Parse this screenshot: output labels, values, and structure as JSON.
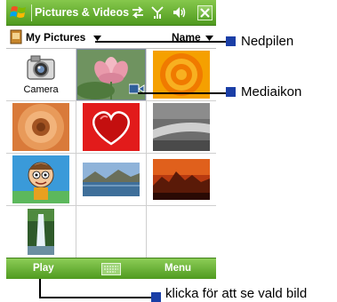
{
  "title_bar": {
    "app_title": "Pictures & Videos",
    "icons": [
      "windows-start-flag-icon",
      "connectivity-icon",
      "signal-icon",
      "volume-icon",
      "close-icon"
    ]
  },
  "folder_bar": {
    "folder_label": "My Pictures",
    "sort_label": "Name"
  },
  "grid": {
    "camera_label": "Camera",
    "thumbnails": [
      "camera",
      "lotus-flower",
      "orange-rings",
      "sunflower",
      "red-heart",
      "blurred-gray",
      "cartoon-character",
      "lake-mountains",
      "sunset-landscape",
      "waterfall"
    ]
  },
  "menu_bar": {
    "left_softkey": "Play",
    "right_softkey": "Menu",
    "center_icon": "keyboard-icon"
  },
  "callouts": {
    "down_arrow": "Nedpilen",
    "media_icon": "Mediaikon",
    "play_hint": "klicka för att se vald bild"
  },
  "colors": {
    "bar_green_top": "#86c84c",
    "bar_green_bottom": "#4f9a1f",
    "callout_marker": "#1a3ea6"
  }
}
